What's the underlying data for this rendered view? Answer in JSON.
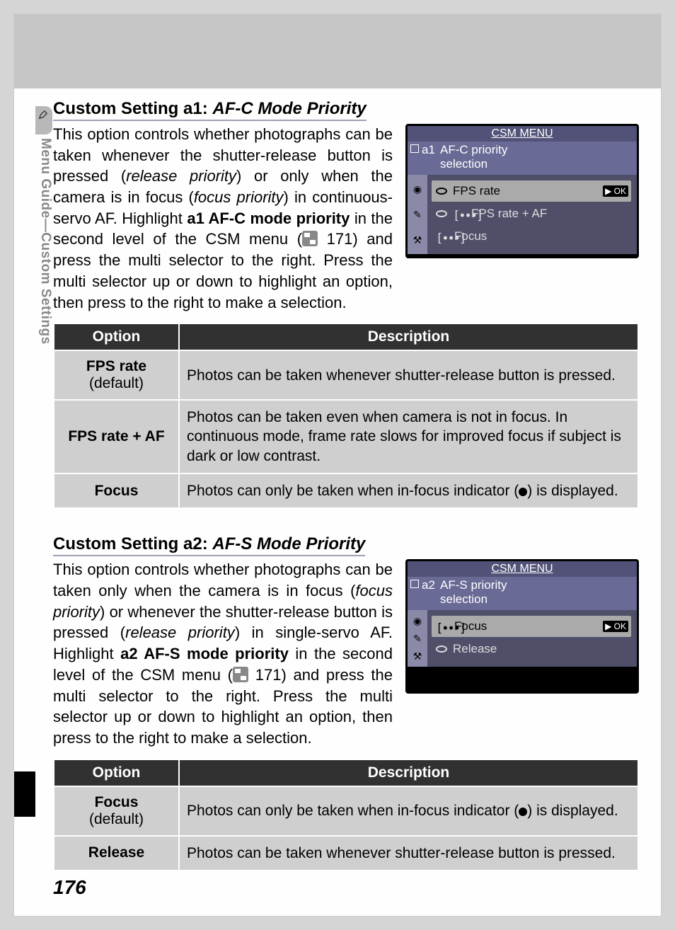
{
  "sidebar_text": "Menu Guide—Custom Settings",
  "page_number": "176",
  "section1": {
    "heading_prefix": "Custom Setting a1: ",
    "heading_italic": "AF-C Mode Priority",
    "para_html": "This option controls whether photographs can be taken whenever the shutter-release button is pressed (<em>release priority</em>) or only when the camera is in focus (<em>focus priority</em>) in continuous-servo AF. Highlight <b>a1 AF-C mode priority</b> in the second level of the CSM menu (<span class='ref-icon' data-name='page-ref-icon' data-interactable='false'></span> 171) and press the multi selector to the right.  Press the multi selector up or down to highlight an option, then press to the right to make a selection.",
    "lcd": {
      "title": "CSM MENU",
      "code": "a1",
      "sub1": "AF-C priority",
      "sub2": "selection",
      "options": [
        {
          "icon": "dial",
          "label": "FPS rate",
          "selected": true
        },
        {
          "icon": "both",
          "label": "FPS rate + AF",
          "selected": false
        },
        {
          "icon": "bracket",
          "label": "Focus",
          "selected": false
        }
      ]
    },
    "table": {
      "headers": {
        "option": "Option",
        "desc": "Description"
      },
      "rows": [
        {
          "opt": "FPS rate",
          "def": "(default)",
          "desc": "Photos can be taken whenever shutter-release button is pressed."
        },
        {
          "opt": "FPS rate + AF",
          "def": "",
          "desc": "Photos can be taken even when camera is not in focus.  In continuous mode, frame rate slows for improved focus if subject is dark or low contrast."
        },
        {
          "opt": "Focus",
          "def": "",
          "desc_html": "Photos can only be taken when in-focus indicator (<span class='dot' data-name='focus-dot-icon' data-interactable='false'></span>) is displayed."
        }
      ]
    }
  },
  "section2": {
    "heading_prefix": "Custom Setting a2: ",
    "heading_italic": "AF-S Mode Priority",
    "para_html": "This option controls whether photographs can be taken only when the camera is in focus (<em>focus priority</em>) or whenever the shutter-release button is pressed (<em>release priority</em>) in single-servo AF.  Highlight <b>a2 AF-S mode priority</b> in the second level of the CSM menu (<span class='ref-icon' data-name='page-ref-icon' data-interactable='false'></span> 171) and press the multi selector to the right.  Press the multi selector up or down to highlight an option, then press to the right to make a selection.",
    "lcd": {
      "title": "CSM MENU",
      "code": "a2",
      "sub1": "AF-S priority",
      "sub2": "selection",
      "options": [
        {
          "icon": "bracket",
          "label": "Focus",
          "selected": true
        },
        {
          "icon": "dial",
          "label": "Release",
          "selected": false
        }
      ]
    },
    "table": {
      "headers": {
        "option": "Option",
        "desc": "Description"
      },
      "rows": [
        {
          "opt": "Focus",
          "def": "(default)",
          "desc_html": "Photos can only be taken when in-focus indicator (<span class='dot' data-name='focus-dot-icon' data-interactable='false'></span>) is displayed."
        },
        {
          "opt": "Release",
          "def": "",
          "desc": "Photos can be taken whenever shutter-release button is pressed."
        }
      ]
    }
  },
  "ok_label": "OK"
}
